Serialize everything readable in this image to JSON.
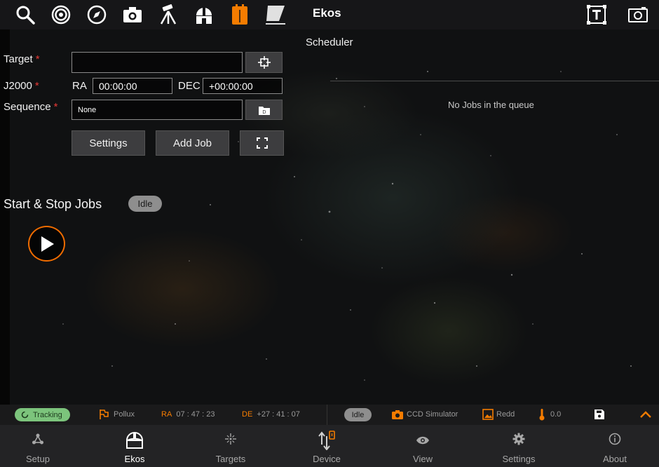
{
  "app": {
    "title": "Ekos"
  },
  "toolbar": {
    "icons": [
      "search-icon",
      "target-rings-icon",
      "compass-icon",
      "camera-icon",
      "tripod-icon",
      "observatory-dome-icon",
      "scheduler-tab-icon",
      "flat-panel-icon"
    ],
    "right_icons": [
      "text-toggle-icon",
      "screenshot-icon"
    ],
    "active_color": "#f57c00"
  },
  "form": {
    "target_label": "Target",
    "target_value": "",
    "j2000_label": "J2000",
    "ra_label": "RA",
    "ra_value": "00:00:00",
    "dec_label": "DEC",
    "dec_value": "+00:00:00",
    "sequence_label": "Sequence",
    "sequence_value": "None",
    "required_mark": "*",
    "settings_button": "Settings",
    "add_job_button": "Add Job"
  },
  "scheduler": {
    "title": "Scheduler",
    "empty_text": "No Jobs in the queue"
  },
  "jobs": {
    "title": "Start & Stop Jobs",
    "state": "Idle"
  },
  "status": {
    "mount_state": "Tracking",
    "mount_name": "Pollux",
    "ra_key": "RA",
    "ra_value": "07 : 47 : 23",
    "de_key": "DE",
    "de_value": "+27 : 41 : 07",
    "capture_state": "Idle",
    "camera_name": "CCD Simulator",
    "filter_name": "Redd",
    "temperature": "0.0"
  },
  "nav": {
    "items": [
      {
        "label": "Setup",
        "icon": "network-nodes-icon"
      },
      {
        "label": "Ekos",
        "icon": "observatory-dome-icon"
      },
      {
        "label": "Targets",
        "icon": "target-star-icon"
      },
      {
        "label": "Device",
        "icon": "device-arrows-icon"
      },
      {
        "label": "View",
        "icon": "eye-icon"
      },
      {
        "label": "Settings",
        "icon": "gear-icon"
      },
      {
        "label": "About",
        "icon": "info-icon"
      }
    ],
    "active": "Ekos"
  }
}
